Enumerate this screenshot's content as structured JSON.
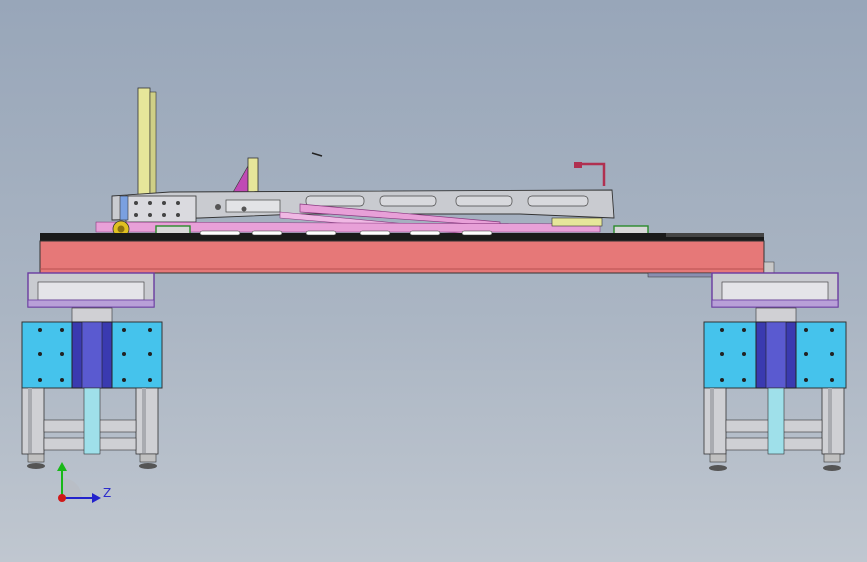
{
  "viewport": {
    "background_top": "#98a6b9",
    "background_bottom": "#c0c7d0"
  },
  "model": {
    "main_beam_color": "#e67878",
    "rail_color": "#1a1a1a",
    "arm_color": "#c9cbd0",
    "accent_pink": "#e8a0d8",
    "accent_yellow": "#e6e69a",
    "accent_magenta": "#c04ab4",
    "block_blue": "#45c3ec",
    "carriage_purple": "#3a3ab0",
    "cylinder_teal": "#9fe0ea"
  },
  "triad": {
    "x_color": "#d01818",
    "y_color": "#18b818",
    "z_color": "#2222cc",
    "z_label": "Z",
    "icons": [
      "coordinate-triad-icon"
    ]
  }
}
